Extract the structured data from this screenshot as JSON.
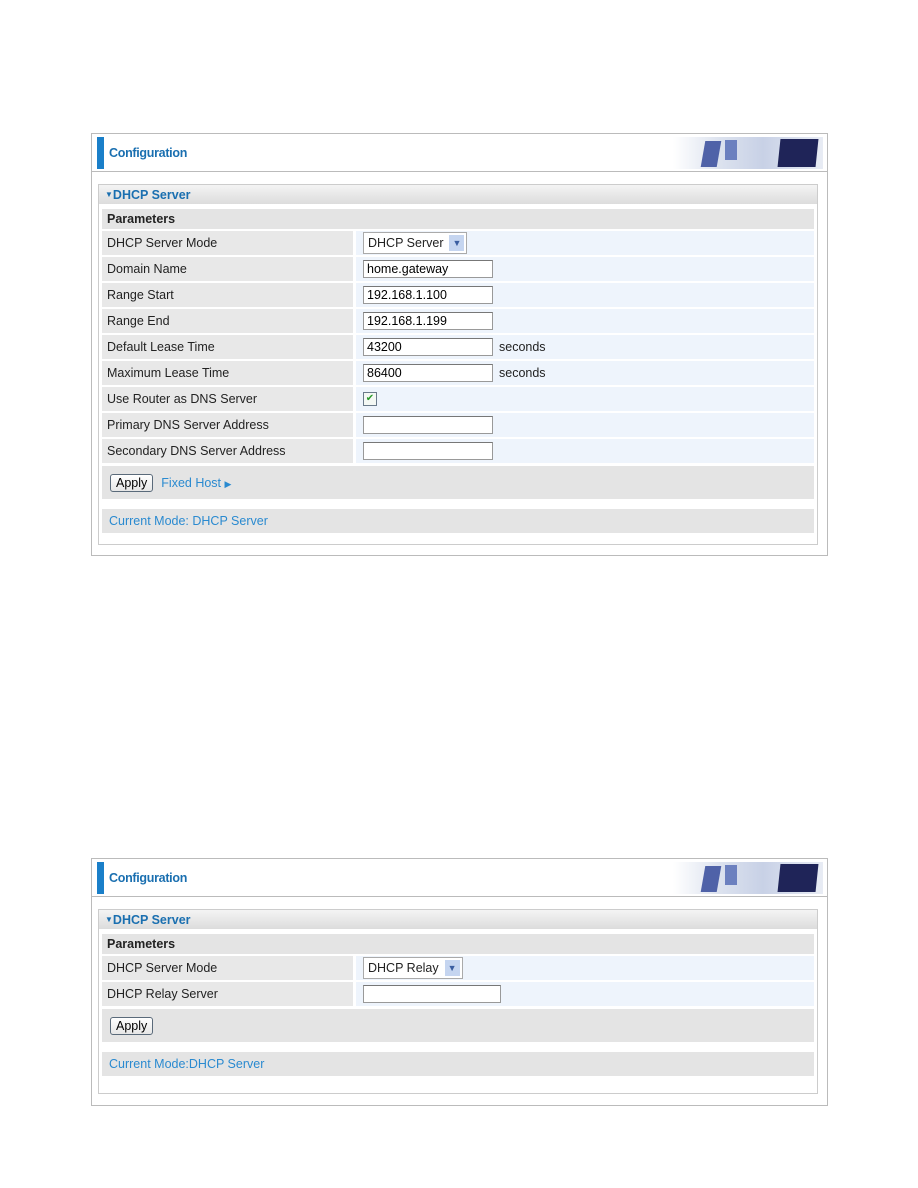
{
  "panel1": {
    "title": "Configuration",
    "section": "DHCP Server",
    "params": "Parameters",
    "rows": [
      {
        "label": "DHCP Server Mode",
        "select": "DHCP Server"
      },
      {
        "label": "Domain Name",
        "value": "home.gateway"
      },
      {
        "label": "Range Start",
        "value": "192.168.1.100"
      },
      {
        "label": "Range End",
        "value": "192.168.1.199"
      },
      {
        "label": "Default Lease Time",
        "value": "43200",
        "unit": "seconds"
      },
      {
        "label": "Maximum Lease Time",
        "value": "86400",
        "unit": "seconds"
      },
      {
        "label": "Use Router as DNS Server",
        "checked": true
      },
      {
        "label": "Primary DNS Server Address",
        "value": ""
      },
      {
        "label": "Secondary DNS Server Address",
        "value": ""
      }
    ],
    "apply": "Apply",
    "fixed_host": "Fixed Host",
    "current_mode": "Current Mode: DHCP Server"
  },
  "panel2": {
    "title": "Configuration",
    "section": "DHCP Server",
    "params": "Parameters",
    "rows": [
      {
        "label": "DHCP Server Mode",
        "select": "DHCP Relay"
      },
      {
        "label": "DHCP Relay Server",
        "value": ""
      }
    ],
    "apply": "Apply",
    "current_mode": "Current Mode:DHCP Server"
  },
  "colors": {
    "accent": "#1a7fc9",
    "link": "#2a8ad0"
  }
}
